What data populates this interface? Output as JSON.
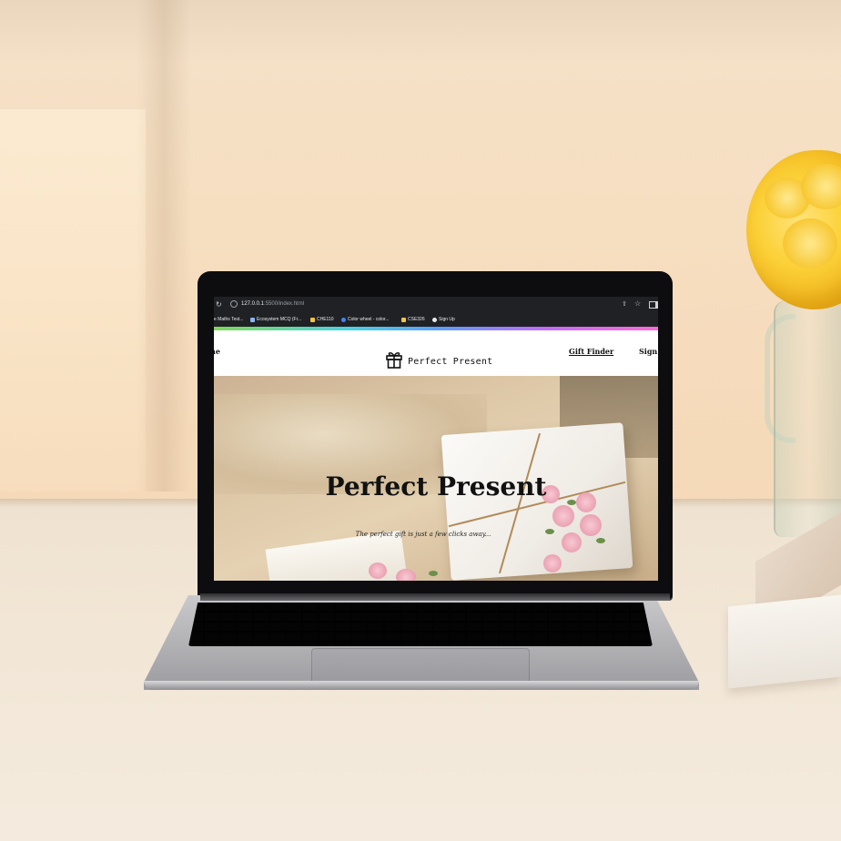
{
  "browser": {
    "url_host": "127.0.0.1",
    "url_path": ":5500/index.html",
    "bookmarks": [
      {
        "label": "e Maths Test...",
        "icon_color": "#8ab4f8"
      },
      {
        "label": "Ecosystem MCQ (Fr...",
        "icon_color": "#8ab4f8"
      },
      {
        "label": "CHE110",
        "icon_color": "#f6c343"
      },
      {
        "label": "Color wheel - color...",
        "icon_color": "#4285f4"
      },
      {
        "label": "CSE326",
        "icon_color": "#f6c343"
      },
      {
        "label": "Sign Up",
        "icon_color": "#e8eaed"
      }
    ]
  },
  "site": {
    "nav_home": "ne",
    "logo_text": "Perfect Present",
    "nav_gift_finder": "Gift Finder",
    "nav_signup": "Sign U"
  },
  "hero": {
    "title": "Perfect Present",
    "subtitle": "The perfect gift is just a few clicks away..."
  },
  "colors": {
    "accent_gradient": [
      "#7ed957",
      "#4ad3e0",
      "#5aa0ff",
      "#c46bff",
      "#ff6bd6"
    ],
    "flower": "#fcd23a"
  },
  "icons": [
    "reload-icon",
    "site-info-icon",
    "share-icon",
    "star-icon",
    "side-panel-icon",
    "gift-icon"
  ]
}
